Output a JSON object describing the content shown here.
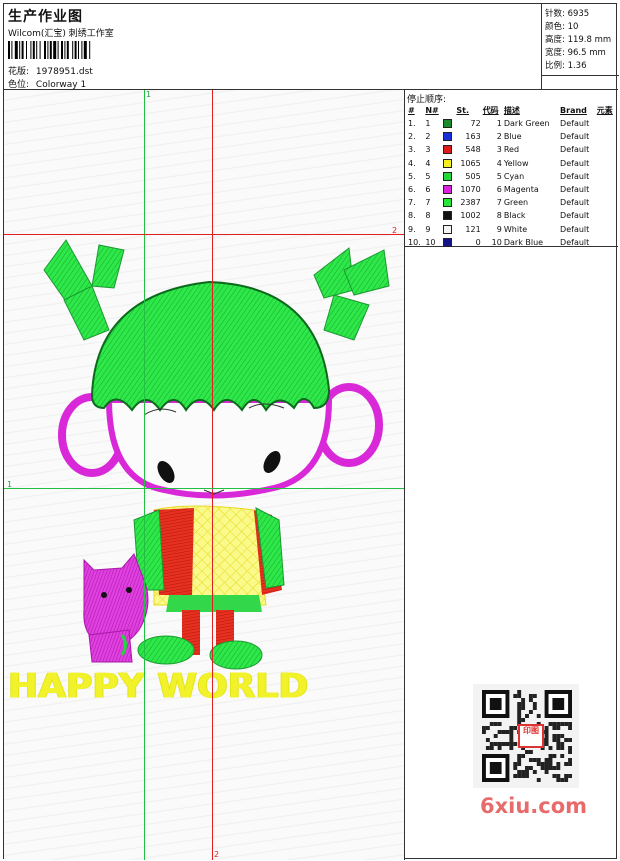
{
  "header": {
    "title": "生产作业图",
    "company": "Wilcom(汇宝) 刺绣工作室",
    "design_label": "花版:",
    "design_value": "1978951.dst",
    "color_label": "色位:",
    "color_value": "Colorway 1"
  },
  "stats": {
    "stitches": "针数: 6935",
    "colors": "颜色: 10",
    "height": "高度: 119.8 mm",
    "width": "宽度: 96.5 mm",
    "scale": "比例: 1.36"
  },
  "stop_sequence": {
    "title": "停止顺序:",
    "headers": [
      "#",
      "N#",
      "St.",
      "代码",
      "描述",
      "Brand",
      "元素"
    ],
    "rows": [
      {
        "idx": "1.",
        "n": "1",
        "st": "72",
        "code": "1",
        "desc": "Dark Green",
        "brand": "Default",
        "color": "#1a8a2a"
      },
      {
        "idx": "2.",
        "n": "2",
        "st": "163",
        "code": "2",
        "desc": "Blue",
        "brand": "Default",
        "color": "#1530d8"
      },
      {
        "idx": "3.",
        "n": "3",
        "st": "548",
        "code": "3",
        "desc": "Red",
        "brand": "Default",
        "color": "#e01a1a"
      },
      {
        "idx": "4.",
        "n": "4",
        "st": "1065",
        "code": "4",
        "desc": "Yellow",
        "brand": "Default",
        "color": "#f4f020"
      },
      {
        "idx": "5.",
        "n": "5",
        "st": "505",
        "code": "5",
        "desc": "Cyan",
        "brand": "Default",
        "color": "#22d83a"
      },
      {
        "idx": "6.",
        "n": "6",
        "st": "1070",
        "code": "6",
        "desc": "Magenta",
        "brand": "Default",
        "color": "#e020e0"
      },
      {
        "idx": "7.",
        "n": "7",
        "st": "2387",
        "code": "7",
        "desc": "Green",
        "brand": "Default",
        "color": "#26e63c"
      },
      {
        "idx": "8.",
        "n": "8",
        "st": "1002",
        "code": "8",
        "desc": "Black",
        "brand": "Default",
        "color": "#111111"
      },
      {
        "idx": "9.",
        "n": "9",
        "st": "121",
        "code": "9",
        "desc": "White",
        "brand": "Default",
        "color": "#f4f4f4"
      },
      {
        "idx": "10.",
        "n": "10",
        "st": "0",
        "code": "10",
        "desc": "Dark Blue",
        "brand": "Default",
        "color": "#14148a"
      }
    ]
  },
  "guides": {
    "v1": "1",
    "v2": "2",
    "h1": "1",
    "h2": "2"
  },
  "design": {
    "text": "HAPPY WORLD"
  },
  "watermark": {
    "text": "6xiu.com",
    "seal": "印图"
  }
}
